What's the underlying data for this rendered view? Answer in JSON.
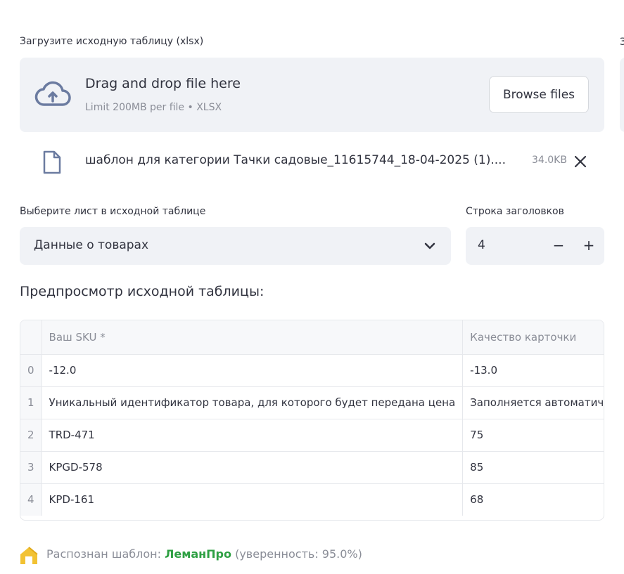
{
  "uploader": {
    "label": "Загрузите исходную таблицу (xlsx)",
    "drop_title": "Drag and drop file here",
    "drop_sub": "Limit 200MB per file • XLSX",
    "browse_label": "Browse files",
    "cut_label": "З"
  },
  "file": {
    "name": "шаблон для категории Тачки садовые_11615744_18-04-2025 (1)....",
    "size": "34.0KB"
  },
  "sheet": {
    "label": "Выберите лист в исходной таблице",
    "value": "Данные о товарах"
  },
  "header_row": {
    "label": "Строка заголовков",
    "value": "4",
    "minus": "−",
    "plus": "+"
  },
  "preview": {
    "title": "Предпросмотр исходной таблицы:",
    "columns": [
      "",
      "Ваш SKU *",
      "Качество карточки"
    ],
    "rows": [
      [
        "0",
        "-12.0",
        "-13.0"
      ],
      [
        "1",
        "Уникальный идентификатор товара, для которого будет передана цена",
        "Заполняется автоматически"
      ],
      [
        "2",
        "TRD-471",
        "75"
      ],
      [
        "3",
        "KPGD-578",
        "85"
      ],
      [
        "4",
        "KPD-161",
        "68"
      ]
    ]
  },
  "status": {
    "prefix": "Распознан шаблон: ",
    "template": "ЛеманПро",
    "suffix": " (уверенность: 95.0%)",
    "colors": {
      "accent": "#2ea043",
      "icon": "#f2c233"
    }
  }
}
